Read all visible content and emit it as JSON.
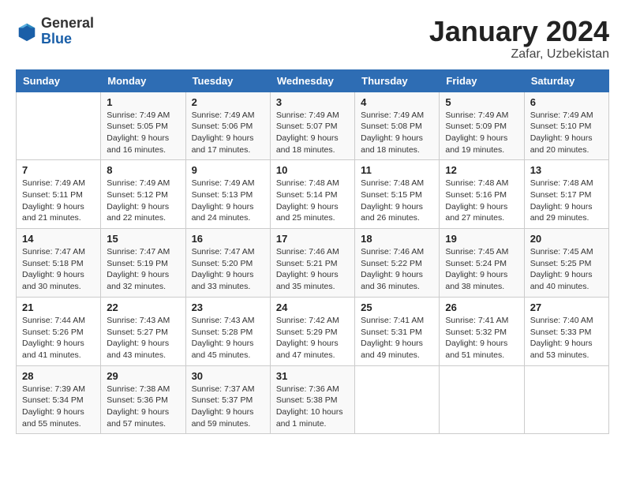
{
  "header": {
    "logo_line1": "General",
    "logo_line2": "Blue",
    "month": "January 2024",
    "location": "Zafar, Uzbekistan"
  },
  "days_of_week": [
    "Sunday",
    "Monday",
    "Tuesday",
    "Wednesday",
    "Thursday",
    "Friday",
    "Saturday"
  ],
  "weeks": [
    [
      {
        "day": "",
        "info": ""
      },
      {
        "day": "1",
        "info": "Sunrise: 7:49 AM\nSunset: 5:05 PM\nDaylight: 9 hours\nand 16 minutes."
      },
      {
        "day": "2",
        "info": "Sunrise: 7:49 AM\nSunset: 5:06 PM\nDaylight: 9 hours\nand 17 minutes."
      },
      {
        "day": "3",
        "info": "Sunrise: 7:49 AM\nSunset: 5:07 PM\nDaylight: 9 hours\nand 18 minutes."
      },
      {
        "day": "4",
        "info": "Sunrise: 7:49 AM\nSunset: 5:08 PM\nDaylight: 9 hours\nand 18 minutes."
      },
      {
        "day": "5",
        "info": "Sunrise: 7:49 AM\nSunset: 5:09 PM\nDaylight: 9 hours\nand 19 minutes."
      },
      {
        "day": "6",
        "info": "Sunrise: 7:49 AM\nSunset: 5:10 PM\nDaylight: 9 hours\nand 20 minutes."
      }
    ],
    [
      {
        "day": "7",
        "info": "Sunrise: 7:49 AM\nSunset: 5:11 PM\nDaylight: 9 hours\nand 21 minutes."
      },
      {
        "day": "8",
        "info": "Sunrise: 7:49 AM\nSunset: 5:12 PM\nDaylight: 9 hours\nand 22 minutes."
      },
      {
        "day": "9",
        "info": "Sunrise: 7:49 AM\nSunset: 5:13 PM\nDaylight: 9 hours\nand 24 minutes."
      },
      {
        "day": "10",
        "info": "Sunrise: 7:48 AM\nSunset: 5:14 PM\nDaylight: 9 hours\nand 25 minutes."
      },
      {
        "day": "11",
        "info": "Sunrise: 7:48 AM\nSunset: 5:15 PM\nDaylight: 9 hours\nand 26 minutes."
      },
      {
        "day": "12",
        "info": "Sunrise: 7:48 AM\nSunset: 5:16 PM\nDaylight: 9 hours\nand 27 minutes."
      },
      {
        "day": "13",
        "info": "Sunrise: 7:48 AM\nSunset: 5:17 PM\nDaylight: 9 hours\nand 29 minutes."
      }
    ],
    [
      {
        "day": "14",
        "info": "Sunrise: 7:47 AM\nSunset: 5:18 PM\nDaylight: 9 hours\nand 30 minutes."
      },
      {
        "day": "15",
        "info": "Sunrise: 7:47 AM\nSunset: 5:19 PM\nDaylight: 9 hours\nand 32 minutes."
      },
      {
        "day": "16",
        "info": "Sunrise: 7:47 AM\nSunset: 5:20 PM\nDaylight: 9 hours\nand 33 minutes."
      },
      {
        "day": "17",
        "info": "Sunrise: 7:46 AM\nSunset: 5:21 PM\nDaylight: 9 hours\nand 35 minutes."
      },
      {
        "day": "18",
        "info": "Sunrise: 7:46 AM\nSunset: 5:22 PM\nDaylight: 9 hours\nand 36 minutes."
      },
      {
        "day": "19",
        "info": "Sunrise: 7:45 AM\nSunset: 5:24 PM\nDaylight: 9 hours\nand 38 minutes."
      },
      {
        "day": "20",
        "info": "Sunrise: 7:45 AM\nSunset: 5:25 PM\nDaylight: 9 hours\nand 40 minutes."
      }
    ],
    [
      {
        "day": "21",
        "info": "Sunrise: 7:44 AM\nSunset: 5:26 PM\nDaylight: 9 hours\nand 41 minutes."
      },
      {
        "day": "22",
        "info": "Sunrise: 7:43 AM\nSunset: 5:27 PM\nDaylight: 9 hours\nand 43 minutes."
      },
      {
        "day": "23",
        "info": "Sunrise: 7:43 AM\nSunset: 5:28 PM\nDaylight: 9 hours\nand 45 minutes."
      },
      {
        "day": "24",
        "info": "Sunrise: 7:42 AM\nSunset: 5:29 PM\nDaylight: 9 hours\nand 47 minutes."
      },
      {
        "day": "25",
        "info": "Sunrise: 7:41 AM\nSunset: 5:31 PM\nDaylight: 9 hours\nand 49 minutes."
      },
      {
        "day": "26",
        "info": "Sunrise: 7:41 AM\nSunset: 5:32 PM\nDaylight: 9 hours\nand 51 minutes."
      },
      {
        "day": "27",
        "info": "Sunrise: 7:40 AM\nSunset: 5:33 PM\nDaylight: 9 hours\nand 53 minutes."
      }
    ],
    [
      {
        "day": "28",
        "info": "Sunrise: 7:39 AM\nSunset: 5:34 PM\nDaylight: 9 hours\nand 55 minutes."
      },
      {
        "day": "29",
        "info": "Sunrise: 7:38 AM\nSunset: 5:36 PM\nDaylight: 9 hours\nand 57 minutes."
      },
      {
        "day": "30",
        "info": "Sunrise: 7:37 AM\nSunset: 5:37 PM\nDaylight: 9 hours\nand 59 minutes."
      },
      {
        "day": "31",
        "info": "Sunrise: 7:36 AM\nSunset: 5:38 PM\nDaylight: 10 hours\nand 1 minute."
      },
      {
        "day": "",
        "info": ""
      },
      {
        "day": "",
        "info": ""
      },
      {
        "day": "",
        "info": ""
      }
    ]
  ]
}
